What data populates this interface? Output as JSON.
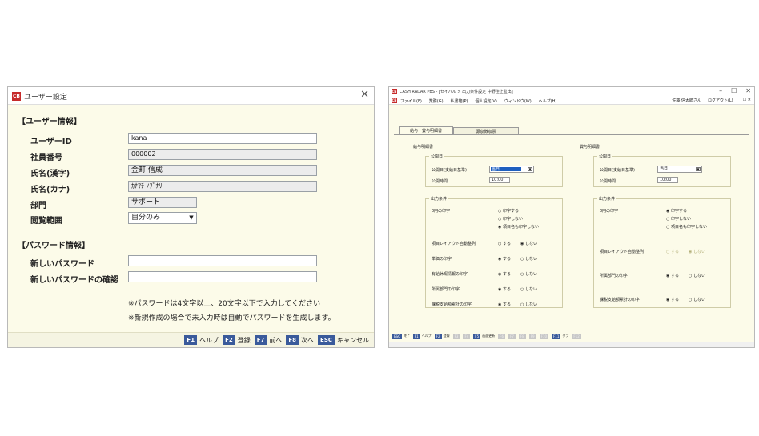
{
  "dialog": {
    "title": "ユーザー設定",
    "logo": "CB",
    "close_glyph": "✕",
    "user_section": "【ユーザー情報】",
    "fields": [
      {
        "label": "ユーザーID",
        "value": "kana"
      },
      {
        "label": "社員番号",
        "value": "000002"
      },
      {
        "label": "氏名(漢字)",
        "value": "金町 信成"
      },
      {
        "label": "氏名(カナ)",
        "value": "ｶﾅﾏﾁ ﾉﾌﾞﾅﾘ"
      },
      {
        "label": "部門",
        "value": "サポート"
      },
      {
        "label": "閲覧範囲",
        "value": "自分のみ"
      }
    ],
    "password_section": "【パスワード情報】",
    "new_password_label": "新しいパスワード",
    "confirm_password_label": "新しいパスワードの確認",
    "new_password_value": "",
    "confirm_password_value": "",
    "notes": [
      "※パスワードは4文字以上、20文字以下で入力してください",
      "※新規作成の場合で未入力時は自動でパスワードを生成します。"
    ],
    "fkeys": [
      {
        "key": "F1",
        "label": "ヘルプ"
      },
      {
        "key": "F2",
        "label": "登録"
      },
      {
        "key": "F7",
        "label": "前へ"
      },
      {
        "key": "F8",
        "label": "次へ"
      },
      {
        "key": "ESC",
        "label": "キャンセル"
      }
    ]
  },
  "app": {
    "logo": "CB",
    "title": "CASH RADAR PBS - [セイバル > 出力条件設定 中野佳上監出]",
    "window_buttons": [
      "–",
      "☐",
      "✕"
    ],
    "menus": [
      "ファイル(F)",
      "業務(G)",
      "私書箱(P)",
      "個人設定(V)",
      "ウィンドウ(W)",
      "ヘルプ(H)"
    ],
    "user_name": "佐藤 信太郎さん",
    "logout": "ログアウト(L)",
    "mini_controls": "_ ☐ ✕",
    "tabs": [
      "給与・賞与明細書",
      "源泉徴収票"
    ],
    "salary": {
      "title": "給与明細書",
      "public_group": "公開日",
      "public_date_label": "公開日(支給日基準)",
      "public_date_value": "当日",
      "public_time_label": "公開時間",
      "public_time_value": "10:00",
      "output_group": "出力条件",
      "zero_label": "0円の印字",
      "zero_options": [
        "印字する",
        "印字しない",
        "項目名も印字しない"
      ],
      "zero_selected": 2,
      "rows": [
        {
          "label": "項目レイアウト自動整列",
          "options": [
            "する",
            "しない"
          ],
          "selected": 1
        },
        {
          "label": "単価の印字",
          "options": [
            "する",
            "しない"
          ],
          "selected": 0
        },
        {
          "label": "有給休暇情報の印字",
          "options": [
            "する",
            "しない"
          ],
          "selected": 0
        },
        {
          "label": "所属部門の印字",
          "options": [
            "する",
            "しない"
          ],
          "selected": 0
        },
        {
          "label": "課税支給額累計の印字",
          "options": [
            "する",
            "しない"
          ],
          "selected": 0
        }
      ]
    },
    "bonus": {
      "title": "賞与明細書",
      "public_group": "公開日",
      "public_date_label": "公開日(支給日基準)",
      "public_date_value": "当日",
      "public_time_label": "公開時間",
      "public_time_value": "10:00",
      "output_group": "出力条件",
      "zero_label": "0円の印字",
      "zero_options": [
        "印字する",
        "印字しない",
        "項目名も印字しない"
      ],
      "zero_selected": 0,
      "rows": [
        {
          "label": "項目レイアウト自動整列",
          "options": [
            "する",
            "しない"
          ],
          "selected": 1,
          "disabled": true
        },
        {
          "label": "所属部門の印字",
          "options": [
            "する",
            "しない"
          ],
          "selected": 0
        },
        {
          "label": "課税支給額累計の印字",
          "options": [
            "する",
            "しない"
          ],
          "selected": 0
        }
      ]
    },
    "fkeys": [
      {
        "key": "ESC",
        "label": "終了",
        "on": true
      },
      {
        "key": "F1",
        "label": "ヘルプ",
        "on": true
      },
      {
        "key": "F2",
        "label": "登録",
        "on": true
      },
      {
        "key": "F3",
        "label": "",
        "on": false
      },
      {
        "key": "F4",
        "label": "",
        "on": false
      },
      {
        "key": "F5",
        "label": "画面更新",
        "on": true
      },
      {
        "key": "F6",
        "label": "",
        "on": false
      },
      {
        "key": "F7",
        "label": "",
        "on": false
      },
      {
        "key": "F8",
        "label": "",
        "on": false
      },
      {
        "key": "F9",
        "label": "",
        "on": false
      },
      {
        "key": "F10",
        "label": "",
        "on": false
      },
      {
        "key": "F11",
        "label": "タブ",
        "on": true
      },
      {
        "key": "F12",
        "label": "",
        "on": false
      }
    ]
  }
}
